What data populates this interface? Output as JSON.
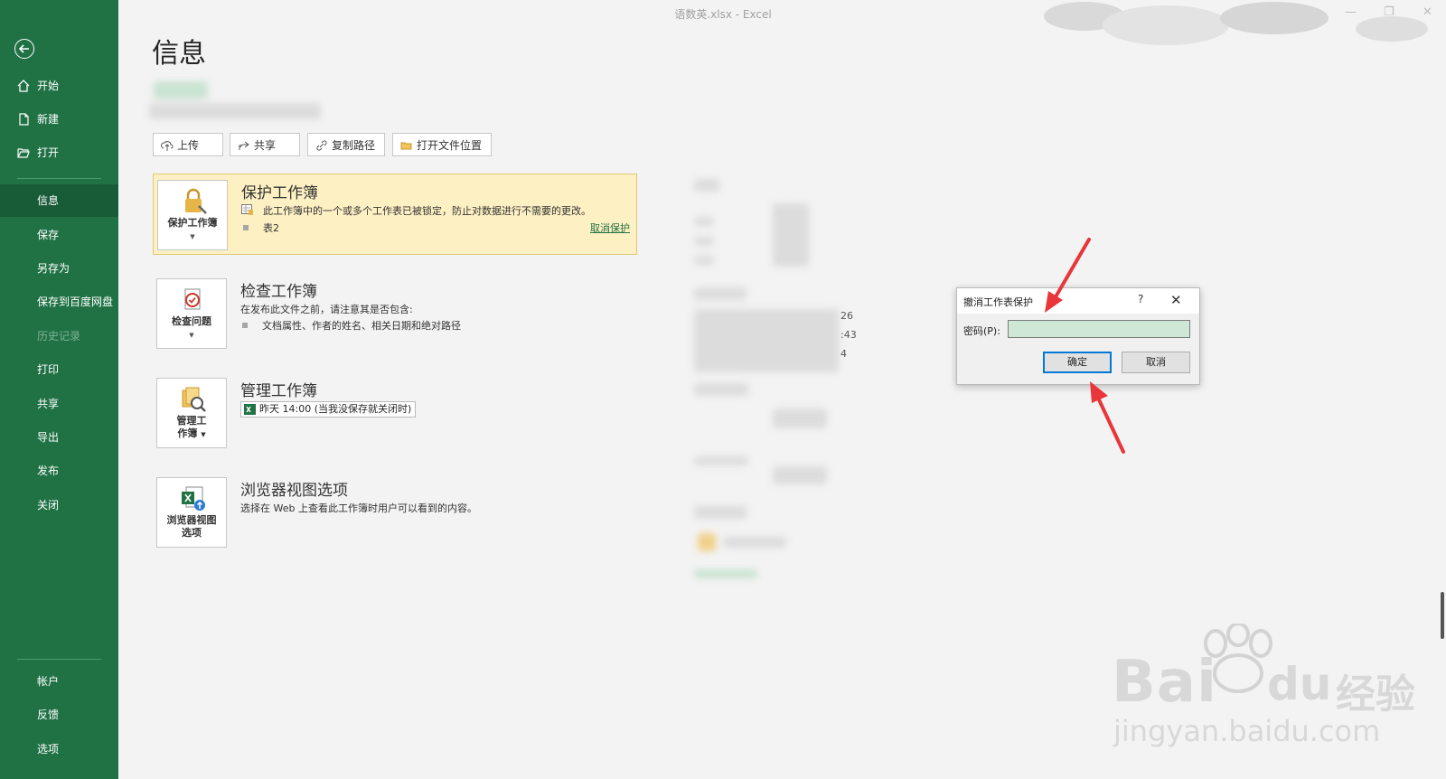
{
  "window": {
    "title": "语数英.xlsx  -  Excel"
  },
  "sidebar": {
    "top_items": [
      {
        "label": "开始",
        "icon": "home-icon"
      },
      {
        "label": "新建",
        "icon": "new-file-icon"
      },
      {
        "label": "打开",
        "icon": "folder-open-icon"
      }
    ],
    "items": [
      {
        "label": "信息",
        "active": true
      },
      {
        "label": "保存"
      },
      {
        "label": "另存为"
      },
      {
        "label": "保存到百度网盘"
      },
      {
        "label": "历史记录",
        "disabled": true
      },
      {
        "label": "打印"
      },
      {
        "label": "共享"
      },
      {
        "label": "导出"
      },
      {
        "label": "发布"
      },
      {
        "label": "关闭"
      }
    ],
    "bottom_items": [
      {
        "label": "帐户"
      },
      {
        "label": "反馈"
      },
      {
        "label": "选项"
      }
    ]
  },
  "page": {
    "title": "信息"
  },
  "toolbar": {
    "upload": "上传",
    "share": "共享",
    "copy_path": "复制路径",
    "open_location": "打开文件位置"
  },
  "sections": {
    "protect": {
      "tile_label": "保护工作簿",
      "title": "保护工作簿",
      "text": "此工作簿中的一个或多个工作表已被锁定，防止对数据进行不需要的更改。",
      "sheet": "表2",
      "unprotect_link": "取消保护"
    },
    "inspect": {
      "tile_label": "检查问题",
      "title": "检查工作簿",
      "text": "在发布此文件之前，请注意其是否包含:",
      "bullet": "文档属性、作者的姓名、相关日期和绝对路径"
    },
    "manage": {
      "tile_label_1": "管理工",
      "tile_label_2": "作簿",
      "title": "管理工作簿",
      "version": "昨天 14:00 (当我没保存就关闭时)"
    },
    "browser": {
      "tile_label_1": "浏览器视图",
      "tile_label_2": "选项",
      "title": "浏览器视图选项",
      "text": "选择在 Web 上查看此工作簿时用户可以看到的内容。"
    }
  },
  "properties_fragments": [
    "26",
    ":43",
    "4"
  ],
  "dialog": {
    "title": "撤消工作表保护",
    "help": "?",
    "password_label": "密码(P):",
    "password_value": "",
    "ok": "确定",
    "cancel": "取消"
  },
  "watermark": {
    "brand": "Bai",
    "brand2": "du",
    "cn": "经验",
    "url": "jingyan.baidu.com"
  },
  "colors": {
    "sidebar": "#207245",
    "sidebar_active": "#185c37",
    "highlight": "#fdf0c3",
    "arrow": "#e8363a",
    "dialog_primary": "#0078d7"
  }
}
